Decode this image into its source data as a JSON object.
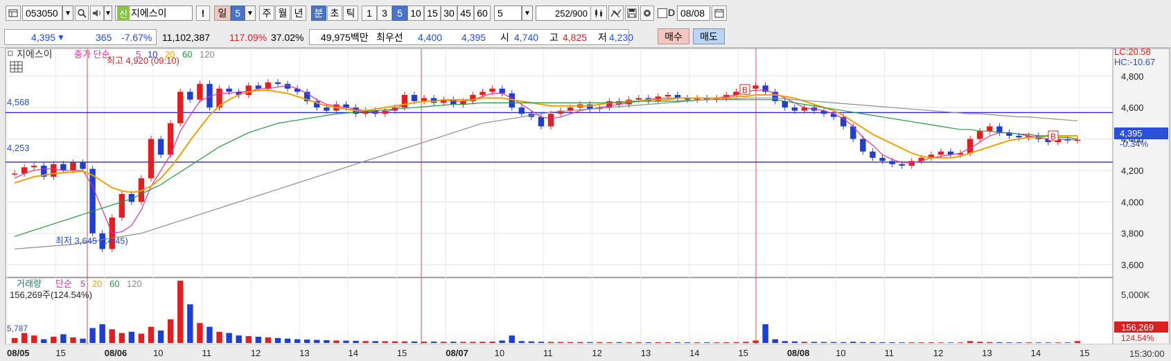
{
  "toolbar": {
    "code": "053050",
    "credit_badge": "신",
    "stock_name": "지에스이",
    "alert": "!",
    "period_day": "일",
    "period_day_n": "5",
    "week": "주",
    "month": "월",
    "year": "년",
    "minute": "분",
    "second": "초",
    "tick": "틱",
    "intervals": [
      "1",
      "3",
      "5",
      "10",
      "15",
      "30",
      "45",
      "60"
    ],
    "selected_interval": "5",
    "interval_select": "5",
    "count": "252",
    "count_max": "/900",
    "date": "08/08",
    "date_prefix": "D"
  },
  "quote": {
    "price": "4,395",
    "change_arrow": "▼",
    "change": "365",
    "change_pct": "-7.67%",
    "volume": "11,102,387",
    "vol_ratio": "117.09%",
    "turnover": "37.02%",
    "amount": "49,975백만",
    "best_label": "최우선",
    "best_ask": "4,400",
    "best_bid": "4,395",
    "open_label": "시",
    "open": "4,740",
    "high_label": "고",
    "high": "4,825",
    "low_label": "저",
    "low": "4,230",
    "buy": "매수",
    "sell": "매도"
  },
  "price_panel": {
    "name": "지에스이",
    "legend_label": "종가 단순",
    "ma": [
      "5",
      "10",
      "20",
      "60",
      "120"
    ],
    "ma_colors": [
      "#e02ea0",
      "#2b39c9",
      "#f0a000",
      "#1f9a3a",
      "#8c8c8c"
    ],
    "high_marker": "최고 4,920 (09:10)",
    "low_marker": "최저 3,645 (14:45)",
    "line_upper": "4,568",
    "line_lower": "4,253",
    "lc": "LC:20.58",
    "hc": "HC:-10.67",
    "last_price": "4,395",
    "last_pct": "-0.34%",
    "signal": "B"
  },
  "volume_panel": {
    "name": "거래량",
    "legend_label": "단순",
    "ma": [
      "5",
      "20",
      "60",
      "120"
    ],
    "info": "156,269주(124.54%)",
    "ma_value": "5,787",
    "axis": "5,000K",
    "last_volume": "156,269",
    "last_pct": "124.54%"
  },
  "x_axis": {
    "labels": [
      "08/05",
      "15",
      "08/06",
      "10",
      "11",
      "12",
      "13",
      "14",
      "15",
      "08/07",
      "10",
      "11",
      "12",
      "13",
      "14",
      "15",
      "08/08",
      "10",
      "11",
      "12",
      "13",
      "14",
      "15"
    ],
    "time": "15:30:00"
  },
  "chart_data": {
    "type": "candlestick",
    "interval": "5분",
    "y_ticks": [
      4800,
      4600,
      4400,
      4200,
      4000,
      3800,
      3600
    ],
    "ylim": [
      3530,
      4940
    ],
    "y_tick_labels": [
      "4,800",
      "4,600",
      "4,400",
      "4,200",
      "4,000",
      "3,800",
      "3,600"
    ],
    "day_separators": [
      "08/06",
      "08/07",
      "08/08"
    ],
    "series_close": [
      4180,
      4220,
      4230,
      4160,
      4240,
      4200,
      4250,
      4210,
      3800,
      3700,
      3900,
      4050,
      4000,
      4150,
      4400,
      4300,
      4500,
      4700,
      4650,
      4750,
      4600,
      4720,
      4700,
      4680,
      4740,
      4720,
      4760,
      4750,
      4720,
      4700,
      4640,
      4600,
      4580,
      4620,
      4600,
      4560,
      4580,
      4560,
      4580,
      4600,
      4680,
      4640,
      4660,
      4630,
      4650,
      4620,
      4640,
      4680,
      4700,
      4720,
      4690,
      4600,
      4560,
      4540,
      4480,
      4560,
      4580,
      4600,
      4620,
      4590,
      4600,
      4640,
      4620,
      4650,
      4660,
      4640,
      4670,
      4680,
      4660,
      4650,
      4660,
      4650,
      4660,
      4680,
      4700,
      4720,
      4740,
      4700,
      4640,
      4600,
      4580,
      4600,
      4580,
      4560,
      4540,
      4480,
      4400,
      4320,
      4280,
      4260,
      4240,
      4230,
      4260,
      4280,
      4300,
      4320,
      4300,
      4310,
      4400,
      4450,
      4480,
      4440,
      4420,
      4410,
      4420,
      4400,
      4380,
      4400,
      4390,
      4395
    ],
    "ma5": [
      4150,
      4180,
      4200,
      4210,
      4210,
      4200,
      4200,
      4200,
      4100,
      3950,
      3800,
      3810,
      3850,
      3950,
      4100,
      4200,
      4300,
      4450,
      4550,
      4640,
      4670,
      4690,
      4690,
      4700,
      4700,
      4720,
      4720,
      4730,
      4740,
      4720,
      4690,
      4650,
      4620,
      4610,
      4600,
      4590,
      4580,
      4570,
      4570,
      4590,
      4620,
      4630,
      4640,
      4640,
      4650,
      4640,
      4640,
      4650,
      4670,
      4690,
      4690,
      4660,
      4620,
      4580,
      4540,
      4530,
      4540,
      4560,
      4580,
      4590,
      4600,
      4610,
      4620,
      4630,
      4640,
      4650,
      4660,
      4660,
      4660,
      4660,
      4660,
      4660,
      4660,
      4670,
      4680,
      4700,
      4710,
      4710,
      4690,
      4660,
      4630,
      4600,
      4590,
      4580,
      4560,
      4530,
      4480,
      4410,
      4360,
      4300,
      4270,
      4250,
      4250,
      4260,
      4280,
      4290,
      4300,
      4310,
      4340,
      4380,
      4420,
      4440,
      4440,
      4430,
      4420,
      4410,
      4400,
      4400,
      4395,
      4395
    ],
    "ma20": [
      4120,
      4140,
      4160,
      4170,
      4180,
      4185,
      4190,
      4195,
      4170,
      4130,
      4090,
      4070,
      4060,
      4070,
      4100,
      4150,
      4220,
      4300,
      4390,
      4470,
      4550,
      4610,
      4650,
      4680,
      4700,
      4710,
      4710,
      4700,
      4690,
      4670,
      4650,
      4630,
      4610,
      4600,
      4590,
      4580,
      4580,
      4590,
      4600,
      4610,
      4620,
      4630,
      4640,
      4640,
      4650,
      4650,
      4650,
      4650,
      4660,
      4660,
      4660,
      4650,
      4640,
      4630,
      4620,
      4610,
      4610,
      4610,
      4610,
      4610,
      4620,
      4630,
      4630,
      4640,
      4640,
      4650,
      4650,
      4650,
      4660,
      4660,
      4660,
      4660,
      4660,
      4660,
      4670,
      4670,
      4680,
      4680,
      4680,
      4670,
      4660,
      4640,
      4620,
      4600,
      4580,
      4550,
      4510,
      4470,
      4430,
      4400,
      4370,
      4340,
      4310,
      4290,
      4280,
      4280,
      4280,
      4290,
      4310,
      4330,
      4350,
      4370,
      4390,
      4400,
      4410,
      4410,
      4420,
      4420,
      4420,
      4420
    ],
    "ma60": [
      3780,
      3800,
      3820,
      3840,
      3860,
      3880,
      3900,
      3920,
      3940,
      3960,
      3980,
      4000,
      4020,
      4050,
      4080,
      4110,
      4150,
      4190,
      4230,
      4270,
      4310,
      4350,
      4380,
      4410,
      4440,
      4460,
      4480,
      4500,
      4510,
      4520,
      4530,
      4540,
      4550,
      4560,
      4565,
      4570,
      4575,
      4580,
      4585,
      4590,
      4595,
      4600,
      4605,
      4610,
      4615,
      4620,
      4620,
      4625,
      4630,
      4630,
      4630,
      4630,
      4630,
      4630,
      4630,
      4630,
      4630,
      4630,
      4630,
      4630,
      4630,
      4630,
      4635,
      4635,
      4640,
      4640,
      4640,
      4640,
      4640,
      4645,
      4645,
      4650,
      4650,
      4650,
      4650,
      4650,
      4650,
      4650,
      4650,
      4640,
      4630,
      4620,
      4610,
      4600,
      4590,
      4580,
      4570,
      4560,
      4550,
      4540,
      4530,
      4520,
      4510,
      4500,
      4490,
      4480,
      4470,
      4460,
      4460,
      4450,
      4450,
      4440,
      4440,
      4430,
      4430,
      4420,
      4420,
      4410,
      4410,
      4400
    ],
    "ma120": [
      3700,
      3705,
      3710,
      3715,
      3720,
      3725,
      3730,
      3740,
      3750,
      3760,
      3770,
      3780,
      3790,
      3800,
      3820,
      3840,
      3860,
      3880,
      3900,
      3920,
      3940,
      3960,
      3980,
      4000,
      4020,
      4040,
      4060,
      4080,
      4100,
      4120,
      4140,
      4160,
      4180,
      4200,
      4220,
      4240,
      4260,
      4280,
      4300,
      4320,
      4340,
      4360,
      4380,
      4400,
      4420,
      4440,
      4460,
      4480,
      4500,
      4510,
      4520,
      4530,
      4540,
      4550,
      4560,
      4570,
      4575,
      4580,
      4585,
      4590,
      4595,
      4600,
      4605,
      4610,
      4615,
      4620,
      4625,
      4630,
      4635,
      4640,
      4645,
      4650,
      4650,
      4655,
      4655,
      4660,
      4660,
      4660,
      4660,
      4655,
      4650,
      4645,
      4640,
      4635,
      4630,
      4625,
      4620,
      4615,
      4610,
      4605,
      4600,
      4595,
      4590,
      4585,
      4580,
      4575,
      4570,
      4565,
      4560,
      4560,
      4555,
      4550,
      4545,
      4540,
      4540,
      4535,
      4530,
      4525,
      4520,
      4515
    ],
    "volume": [
      80,
      160,
      120,
      60,
      100,
      140,
      90,
      70,
      240,
      300,
      220,
      160,
      180,
      150,
      260,
      200,
      380,
      1000,
      620,
      320,
      260,
      180,
      160,
      120,
      110,
      100,
      90,
      80,
      70,
      60,
      55,
      50,
      45,
      40,
      38,
      35,
      30,
      30,
      28,
      26,
      25,
      24,
      22,
      22,
      20,
      20,
      18,
      18,
      20,
      22,
      40,
      120,
      30,
      25,
      20,
      18,
      16,
      15,
      15,
      14,
      14,
      13,
      13,
      12,
      12,
      12,
      12,
      12,
      11,
      11,
      10,
      10,
      10,
      12,
      14,
      20,
      40,
      300,
      60,
      30,
      25,
      20,
      18,
      16,
      15,
      14,
      20,
      15,
      14,
      12,
      12,
      10,
      10,
      10,
      10,
      9,
      9,
      9,
      30,
      20,
      15,
      12,
      10,
      10,
      10,
      9,
      9,
      9,
      9,
      30
    ]
  }
}
